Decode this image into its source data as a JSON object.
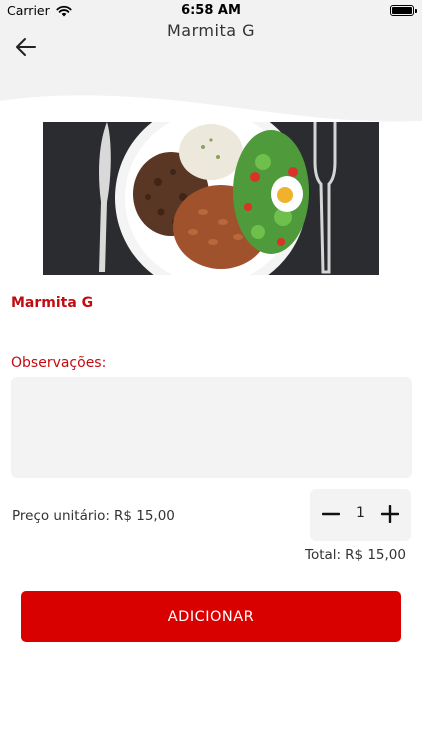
{
  "status_bar": {
    "carrier": "Carrier",
    "time": "6:58 AM",
    "icons": [
      "wifi-icon",
      "battery-icon"
    ]
  },
  "header": {
    "title": "Marmita G",
    "back_icon": "arrow-left-icon"
  },
  "product": {
    "name": "Marmita G",
    "image": "meal-plate-photo"
  },
  "observations": {
    "label": "Observações:",
    "value": "",
    "placeholder": ""
  },
  "pricing": {
    "unit_label": "Preço unitário:",
    "unit_value": "R$ 15,00",
    "quantity": "1",
    "total_label": "Total:",
    "total_value": "R$ 15,00"
  },
  "actions": {
    "add_label": "ADICIONAR"
  },
  "colors": {
    "accent": "#c30c12",
    "button": "#d90000",
    "field_bg": "#f3f3f3",
    "header_bg": "#f2f2f2"
  }
}
